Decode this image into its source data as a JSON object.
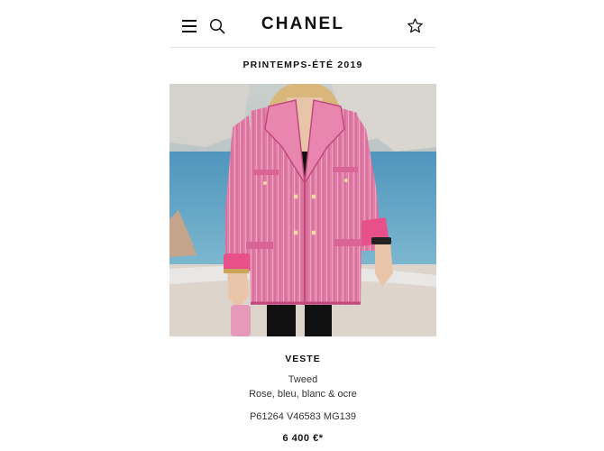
{
  "header": {
    "brand": "CHANEL",
    "menu_icon": "menu-icon",
    "search_icon": "search-icon",
    "favorite_icon": "star-icon"
  },
  "collection": {
    "title": "PRINTEMPS-ÉTÉ 2019"
  },
  "product": {
    "name": "VESTE",
    "material": "Tweed",
    "colors": "Rose, bleu, blanc & ocre",
    "reference": "P61264 V46583 MG139",
    "price": "6 400 €*"
  },
  "theme": {
    "jacket_color": "#e07aa3",
    "cuff_color": "#e8508a",
    "sea_color": "#5f9fc0"
  }
}
